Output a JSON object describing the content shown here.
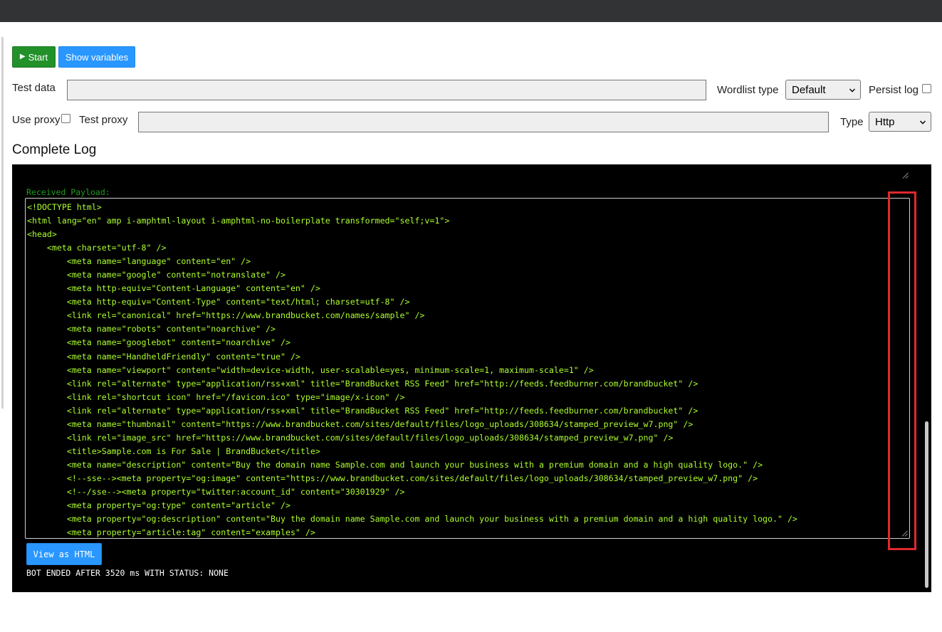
{
  "toolbar": {
    "start_label": "Start",
    "start_icon": "play-icon",
    "show_variables_label": "Show variables"
  },
  "form": {
    "test_data_label": "Test data",
    "test_data_value": "",
    "wordlist_type_label": "Wordlist type",
    "wordlist_type_value": "Default",
    "persist_log_label": "Persist log",
    "persist_log_checked": false,
    "use_proxy_label": "Use proxy",
    "use_proxy_checked": false,
    "test_proxy_label": "Test proxy",
    "test_proxy_value": "",
    "proxy_type_label": "Type",
    "proxy_type_value": "Http"
  },
  "log": {
    "title": "Complete Log",
    "received_payload_label": "Received Payload:",
    "payload_lines": [
      "<!DOCTYPE html>",
      "<html lang=\"en\" amp i-amphtml-layout i-amphtml-no-boilerplate transformed=\"self;v=1\">",
      "<head>",
      "    <meta charset=\"utf-8\" />",
      "        <meta name=\"language\" content=\"en\" />",
      "        <meta name=\"google\" content=\"notranslate\" />",
      "        <meta http-equiv=\"Content-Language\" content=\"en\" />",
      "        <meta http-equiv=\"Content-Type\" content=\"text/html; charset=utf-8\" />",
      "        <link rel=\"canonical\" href=\"https://www.brandbucket.com/names/sample\" />",
      "        <meta name=\"robots\" content=\"noarchive\" />",
      "        <meta name=\"googlebot\" content=\"noarchive\" />",
      "        <meta name=\"HandheldFriendly\" content=\"true\" />",
      "        <meta name=\"viewport\" content=\"width=device-width, user-scalable=yes, minimum-scale=1, maximum-scale=1\" />",
      "        <link rel=\"alternate\" type=\"application/rss+xml\" title=\"BrandBucket RSS Feed\" href=\"http://feeds.feedburner.com/brandbucket\" />",
      "        <link rel=\"shortcut icon\" href=\"/favicon.ico\" type=\"image/x-icon\" />",
      "        <link rel=\"alternate\" type=\"application/rss+xml\" title=\"BrandBucket RSS Feed\" href=\"http://feeds.feedburner.com/brandbucket\" />",
      "        <meta name=\"thumbnail\" content=\"https://www.brandbucket.com/sites/default/files/logo_uploads/308634/stamped_preview_w7.png\" />",
      "        <link rel=\"image_src\" href=\"https://www.brandbucket.com/sites/default/files/logo_uploads/308634/stamped_preview_w7.png\" />",
      "        <title>Sample.com is For Sale | BrandBucket</title>",
      "        <meta name=\"description\" content=\"Buy the domain name Sample.com and launch your business with a premium domain and a high quality logo.\" />",
      "        <!--sse--><meta property=\"og:image\" content=\"https://www.brandbucket.com/sites/default/files/logo_uploads/308634/stamped_preview_w7.png\" />",
      "        <!--/sse--><meta property=\"twitter:account_id\" content=\"30301929\" />",
      "        <meta property=\"og:type\" content=\"article\" />",
      "        <meta property=\"og:description\" content=\"Buy the domain name Sample.com and launch your business with a premium domain and a high quality logo.\" />",
      "        <meta property=\"article:tag\" content=\"examples\" />"
    ],
    "view_as_html_label": "View as HTML",
    "status_text": "BOT ENDED AFTER 3520 ms WITH STATUS: NONE"
  },
  "colors": {
    "start_button": "#22912a",
    "blue_button": "#2997ff",
    "payload_text": "#adff2f",
    "received_label": "#1f9c1f",
    "highlight": "#e0282e"
  }
}
